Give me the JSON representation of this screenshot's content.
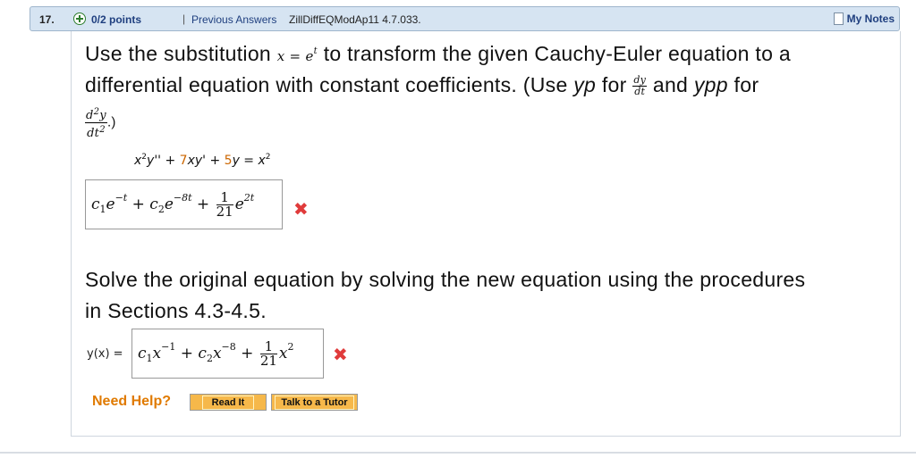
{
  "header": {
    "question_number": "17.",
    "points": "0/2 points",
    "separator": "|",
    "previous_answers": "Previous Answers",
    "problem_code": "ZillDiffEQModAp11 4.7.033.",
    "my_notes": "My Notes"
  },
  "part1": {
    "prompt_a": "Use the substitution",
    "substitution": "x = e",
    "substitution_exp": "t",
    "prompt_b": "to transform the given Cauchy-Euler equation to a",
    "prompt_c": "differential equation with constant coefficients. (Use",
    "yp": "yp",
    "for_1": "for",
    "dy": "dy",
    "dt": "dt",
    "and": "and",
    "ypp": "ypp",
    "for_2": "for",
    "d2y": "d",
    "d2y_exp": "2",
    "d2y_y": "y",
    "dt2": "dt",
    "dt2_exp": "2",
    "close": ".)",
    "equation": {
      "x": "x",
      "x_exp": "2",
      "ypp_term": "y'' +",
      "c1": "7",
      "xyp_term": "xy' +",
      "c2": "5",
      "y_eq": "y = x",
      "rhs_exp": "2"
    },
    "answer": {
      "c1": "c",
      "s1": "1",
      "e1": "e",
      "p1": "−t",
      "plus1": " + ",
      "c2": "c",
      "s2": "2",
      "e2": "e",
      "p2": "−8t",
      "plus2": " + ",
      "num": "1",
      "den": "21",
      "e3": "e",
      "p3": "2t"
    },
    "status": "incorrect"
  },
  "part2": {
    "prompt_a": "Solve the original equation by solving the new equation using the procedures",
    "prompt_b": "in Sections 4.3-4.5.",
    "label": "y(x) =",
    "answer": {
      "c1": "c",
      "s1": "1",
      "x1": "x",
      "p1": "−1",
      "plus1": " + ",
      "c2": "c",
      "s2": "2",
      "x2": "x",
      "p2": "−8",
      "plus2": " + ",
      "num": "1",
      "den": "21",
      "x3": "x",
      "p3": "2"
    },
    "status": "incorrect"
  },
  "help": {
    "label": "Need Help?",
    "read_it": "Read It",
    "talk_tutor": "Talk to a Tutor"
  },
  "marks": {
    "incorrect_symbol": "✖"
  },
  "colors": {
    "accent": "#1f3f7f",
    "header_bg": "#d6e4f2",
    "error": "#e03b3b",
    "help": "#e07a00",
    "button": "#f6b84a",
    "coef": "#cc6600"
  },
  "icons": [
    "plus-icon",
    "notes-icon",
    "incorrect-icon"
  ]
}
